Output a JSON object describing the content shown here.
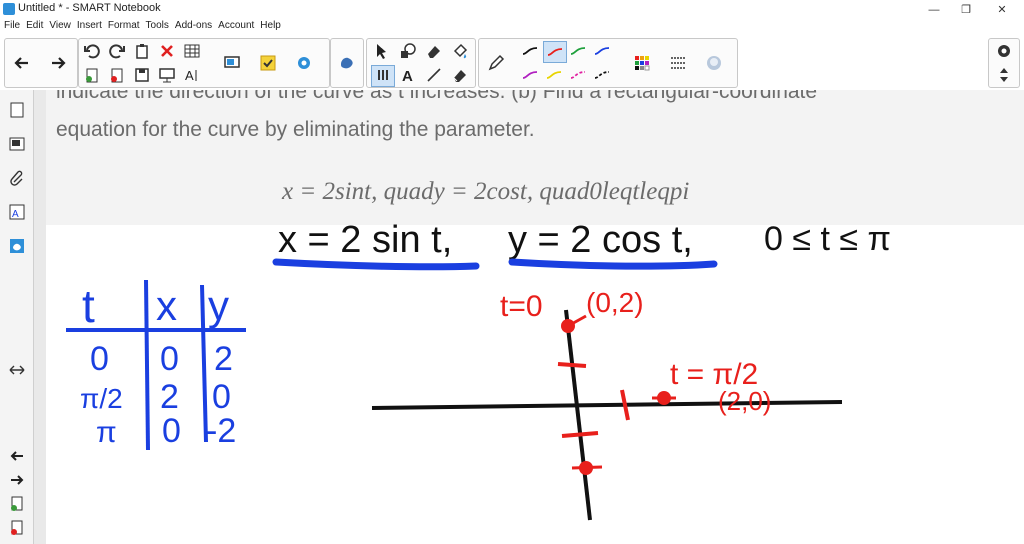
{
  "window": {
    "title": "Untitled * - SMART Notebook"
  },
  "menu": [
    "File",
    "Edit",
    "View",
    "Insert",
    "Format",
    "Tools",
    "Add-ons",
    "Account",
    "Help"
  ],
  "problem": {
    "line1": "indicate the direction of the curve as t increases. (b) Find a rectangular-coordinate",
    "line2": "equation for the curve by eliminating the parameter.",
    "latex": "x = 2sint, quady = 2cost, quad0leqtleqpi"
  },
  "handwriting": {
    "equation_x": "x = 2 sin t,",
    "equation_y": "y = 2 cos t,",
    "range": "0 ≤ t ≤ π",
    "table_headers": [
      "t",
      "x",
      "y"
    ],
    "table_rows": [
      [
        "0",
        "0",
        "2"
      ],
      [
        "π/2",
        "2",
        "0"
      ],
      [
        "π",
        "0",
        "-2"
      ]
    ],
    "label_t0": "t=0",
    "label_02": "(0,2)",
    "label_tpi2": "t = π/2",
    "label_20": "(2,0)"
  },
  "colors": {
    "blue_ink": "#1a3fe0",
    "red_ink": "#e8201c",
    "black_ink": "#111111",
    "highlight": "#1a3fe0"
  },
  "icons": [
    "back-arrow",
    "forward-arrow",
    "undo",
    "redo",
    "paste",
    "delete",
    "table",
    "screen-shade",
    "response",
    "addon",
    "select-arrow",
    "shapes",
    "fill",
    "pen",
    "text",
    "eraser",
    "color-grid",
    "line-style",
    "record"
  ]
}
